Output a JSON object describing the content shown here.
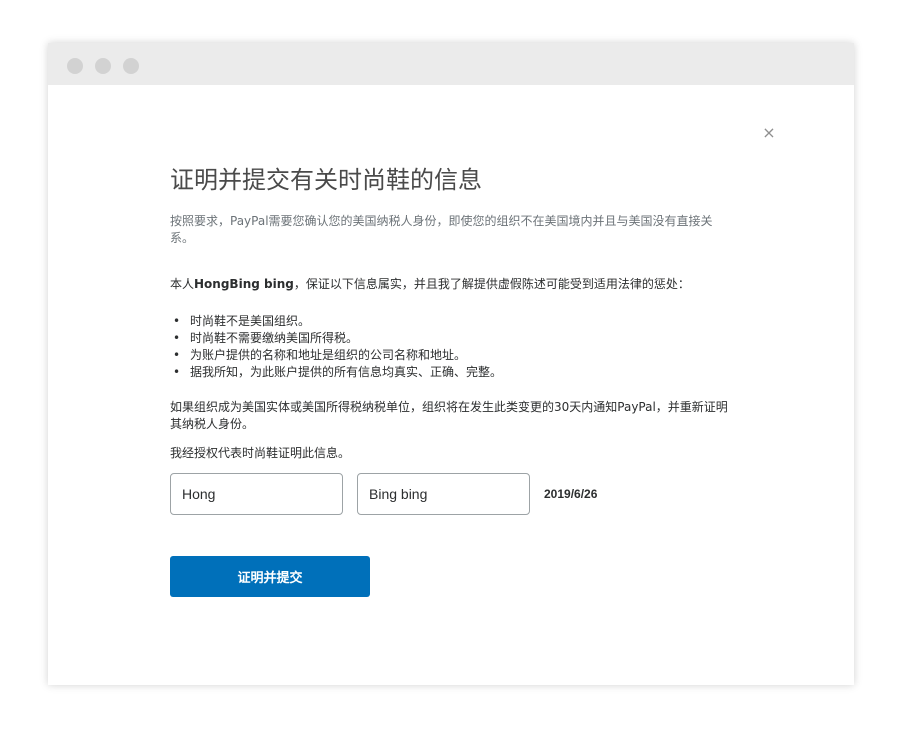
{
  "window": {
    "controls": [
      "red-dot",
      "yellow-dot",
      "green-dot"
    ]
  },
  "dialog": {
    "close_icon": "×",
    "title": "证明并提交有关时尚鞋的信息",
    "description": "按照要求，PayPal需要您确认您的美国纳税人身份，即使您的组织不在美国境内并且与美国没有直接关系。",
    "statement_prefix": "本人",
    "statement_name": "HongBing bing",
    "statement_suffix": "，保证以下信息属实，并且我了解提供虚假陈述可能受到适用法律的惩处：",
    "bullets": [
      "时尚鞋不是美国组织。",
      "时尚鞋不需要缴纳美国所得税。",
      "为账户提供的名称和地址是组织的公司名称和地址。",
      "据我所知，为此账户提供的所有信息均真实、正确、完整。"
    ],
    "notice": "如果组织成为美国实体或美国所得税纳税单位，组织将在发生此类变更的30天内通知PayPal，并重新证明其纳税人身份。",
    "authorized": "我经授权代表时尚鞋证明此信息。",
    "first_name_value": "Hong",
    "last_name_value": "Bing bing",
    "date": "2019/6/26",
    "submit_label": "证明并提交"
  },
  "colors": {
    "primary_button": "#0070ba",
    "titlebar": "#ebebeb",
    "dot": "#d2d2d2"
  }
}
